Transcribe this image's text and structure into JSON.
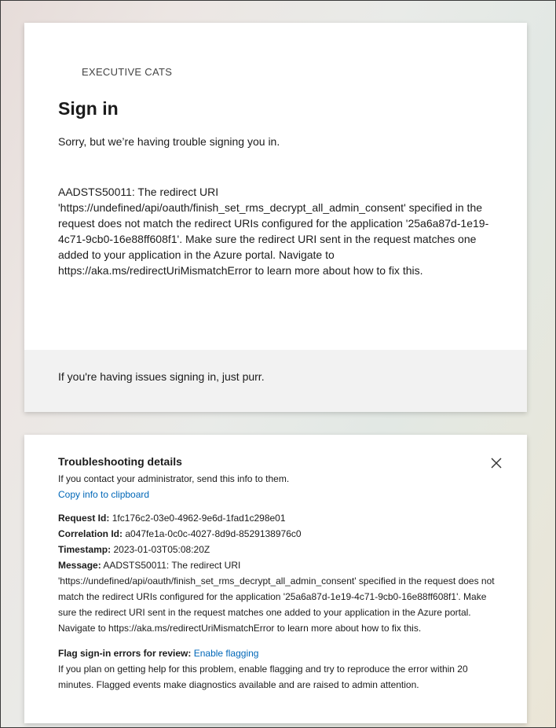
{
  "signin": {
    "brand": "EXECUTIVE CATS",
    "title": "Sign in",
    "subtitle": "Sorry, but we’re having trouble signing you in.",
    "error_message": "AADSTS50011: The redirect URI 'https://undefined/api/oauth/finish_set_rms_decrypt_all_admin_consent' specified in the request does not match the redirect URIs configured for the application '25a6a87d-1e19-4c71-9cb0-16e88ff608f1'. Make sure the redirect URI sent in the request matches one added to your application in the Azure portal. Navigate to https://aka.ms/redirectUriMismatchError to learn more about how to fix this.",
    "footer_text": "If you're having issues signing in, just purr."
  },
  "details": {
    "title": "Troubleshooting details",
    "intro": "If you contact your administrator, send this info to them.",
    "copy_link": "Copy info to clipboard",
    "request_id_label": "Request Id:",
    "request_id": "1fc176c2-03e0-4962-9e6d-1fad1c298e01",
    "correlation_id_label": "Correlation Id:",
    "correlation_id": "a047fe1a-0c0c-4027-8d9d-8529138976c0",
    "timestamp_label": "Timestamp:",
    "timestamp": "2023-01-03T05:08:20Z",
    "message_label": "Message:",
    "message": "AADSTS50011: The redirect URI 'https://undefined/api/oauth/finish_set_rms_decrypt_all_admin_consent' specified in the request does not match the redirect URIs configured for the application '25a6a87d-1e19-4c71-9cb0-16e88ff608f1'. Make sure the redirect URI sent in the request matches one added to your application in the Azure portal. Navigate to https://aka.ms/redirectUriMismatchError to learn more about how to fix this.",
    "flag_label": "Flag sign-in errors for review:",
    "flag_link": "Enable flagging",
    "flag_text": "If you plan on getting help for this problem, enable flagging and try to reproduce the error within 20 minutes. Flagged events make diagnostics available and are raised to admin attention.",
    "close_icon": "close-icon"
  },
  "colors": {
    "link": "#0067b8",
    "footer_band": "#f2f2f2",
    "text": "#1b1b1b"
  }
}
